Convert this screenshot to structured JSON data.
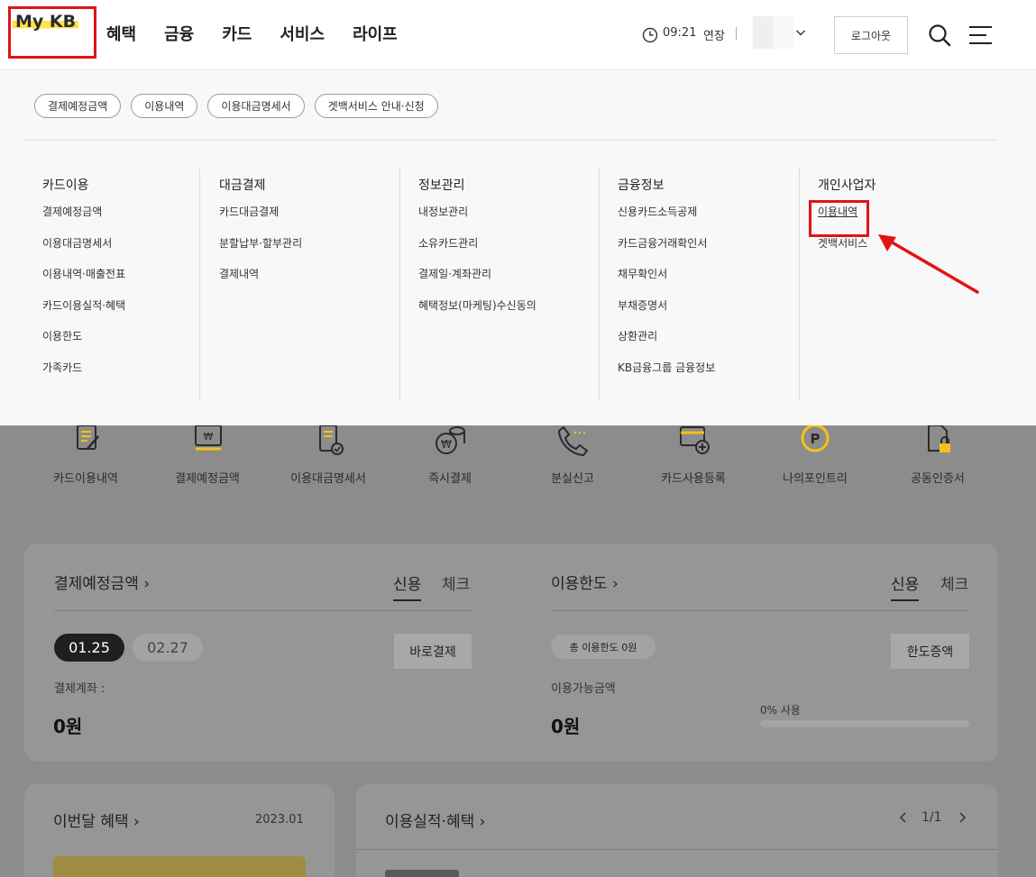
{
  "header": {
    "logo": "My KB",
    "nav": [
      "혜택",
      "금융",
      "카드",
      "서비스",
      "라이프"
    ],
    "time": "09:21",
    "extend": "연장",
    "logout": "로그아웃"
  },
  "mega_menu": {
    "chips": [
      "결제예정금액",
      "이용내역",
      "이용대금명세서",
      "겟백서비스 안내·신청"
    ],
    "columns": [
      {
        "title": "카드이용",
        "items": [
          "결제예정금액",
          "이용대금명세서",
          "이용내역·매출전표",
          "카드이용실적·혜택",
          "이용한도",
          "가족카드"
        ]
      },
      {
        "title": "대금결제",
        "items": [
          "카드대금결제",
          "분할납부·할부관리",
          "결제내역"
        ]
      },
      {
        "title": "정보관리",
        "items": [
          "내정보관리",
          "소유카드관리",
          "결제일·계좌관리",
          "혜택정보(마케팅)수신동의"
        ]
      },
      {
        "title": "금융정보",
        "items": [
          "신용카드소득공제",
          "카드금융거래확인서",
          "채무확인서",
          "부채증명서",
          "상환관리",
          "KB금융그룹 금융정보"
        ]
      },
      {
        "title": "개인사업자",
        "items": [
          "이용내역",
          "겟백서비스"
        ]
      }
    ]
  },
  "quick_menu": [
    "카드이용내역",
    "결제예정금액",
    "이용대금명세서",
    "즉시결제",
    "분실신고",
    "카드사용등록",
    "나의포인트리",
    "공동인증서"
  ],
  "payment_card": {
    "title": "결제예정금액 ›",
    "tab_on": "신용",
    "tab_off": "체크",
    "date_on": "01.25",
    "date_off": "02.27",
    "button": "바로결제",
    "account_label": "결제계좌 :",
    "amount": "0원"
  },
  "limit_card": {
    "title": "이용한도 ›",
    "tab_on": "신용",
    "tab_off": "체크",
    "badge": "총 이용한도 0원",
    "button": "한도증액",
    "available_label": "이용가능금액",
    "amount": "0원",
    "usage": "0% 사용",
    "usage_percent": 0
  },
  "benefit_card": {
    "title": "이번달 혜택 ›",
    "date": "2023.01"
  },
  "perf_card": {
    "title": "이용실적·혜택 ›",
    "pager": "1/1"
  },
  "colors": {
    "highlight": "#e01414",
    "logo_underline": "#ffe14a",
    "icon_yellow": "#f3c21a"
  }
}
